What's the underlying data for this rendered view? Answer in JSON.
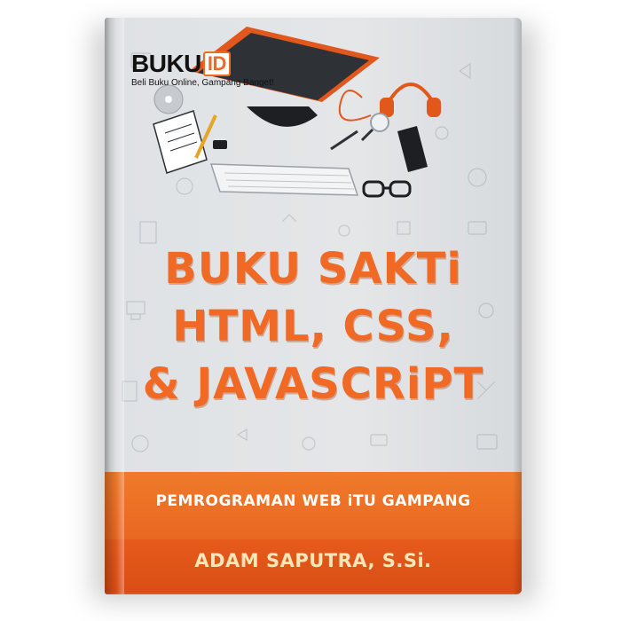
{
  "logo": {
    "brand": "BUKU",
    "brand_suffix": "ID",
    "tagline": "Beli Buku Online, Gampang Banget!"
  },
  "cover": {
    "title_lines": [
      "BUKU SAKTi",
      "HTML, CSS,",
      "& JAVASCRiPT"
    ],
    "subtitle": "PEMROGRAMAN WEB iTU GAMPANG",
    "author": "ADAM SAPUTRA, S.Si."
  },
  "colors": {
    "accent": "#f06a25",
    "band": "#e2571b",
    "cover_bg": "#e4e6e8",
    "author_text": "#f6e6b8"
  }
}
